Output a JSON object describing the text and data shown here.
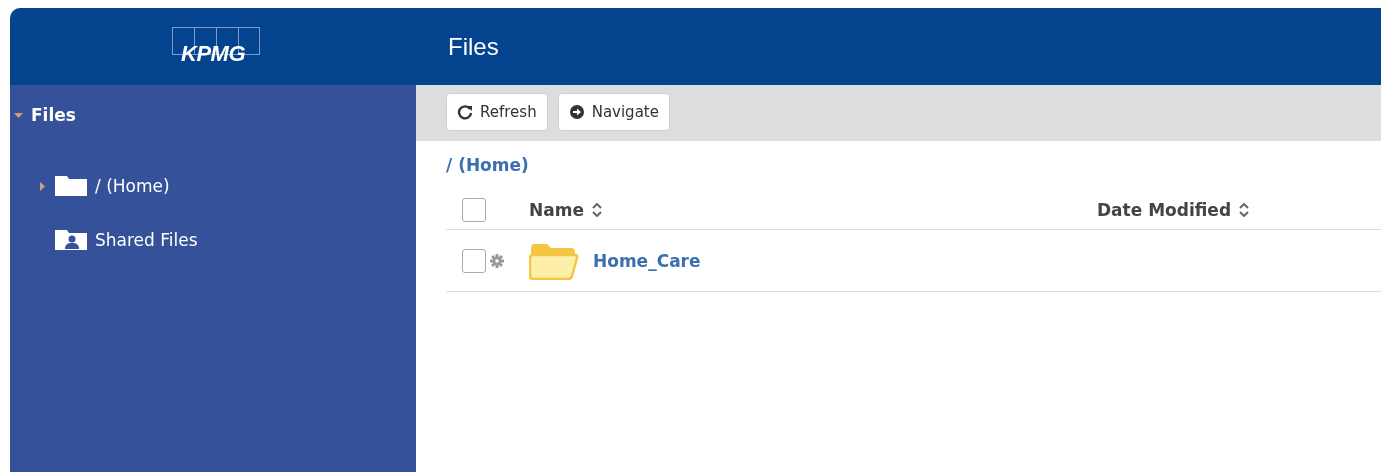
{
  "logo": "KPMG",
  "header": {
    "title": "Files"
  },
  "sidebar": {
    "tree": [
      {
        "label": "Files",
        "expanded": true,
        "children": [
          {
            "label": "/ (Home)",
            "kind": "folder",
            "expanded": false
          },
          {
            "label": "Shared Files",
            "kind": "shared"
          }
        ]
      }
    ]
  },
  "toolbar": {
    "buttons": [
      {
        "label": "Refresh",
        "kind": "refresh"
      },
      {
        "label": "Navigate",
        "kind": "navigate"
      }
    ]
  },
  "breadcrumb": "/ (Home)",
  "table": {
    "select_all_checked": false,
    "columns": [
      "Name",
      "Date Modified"
    ],
    "rows": [
      {
        "name": "Home_Care",
        "checked": false
      }
    ]
  }
}
